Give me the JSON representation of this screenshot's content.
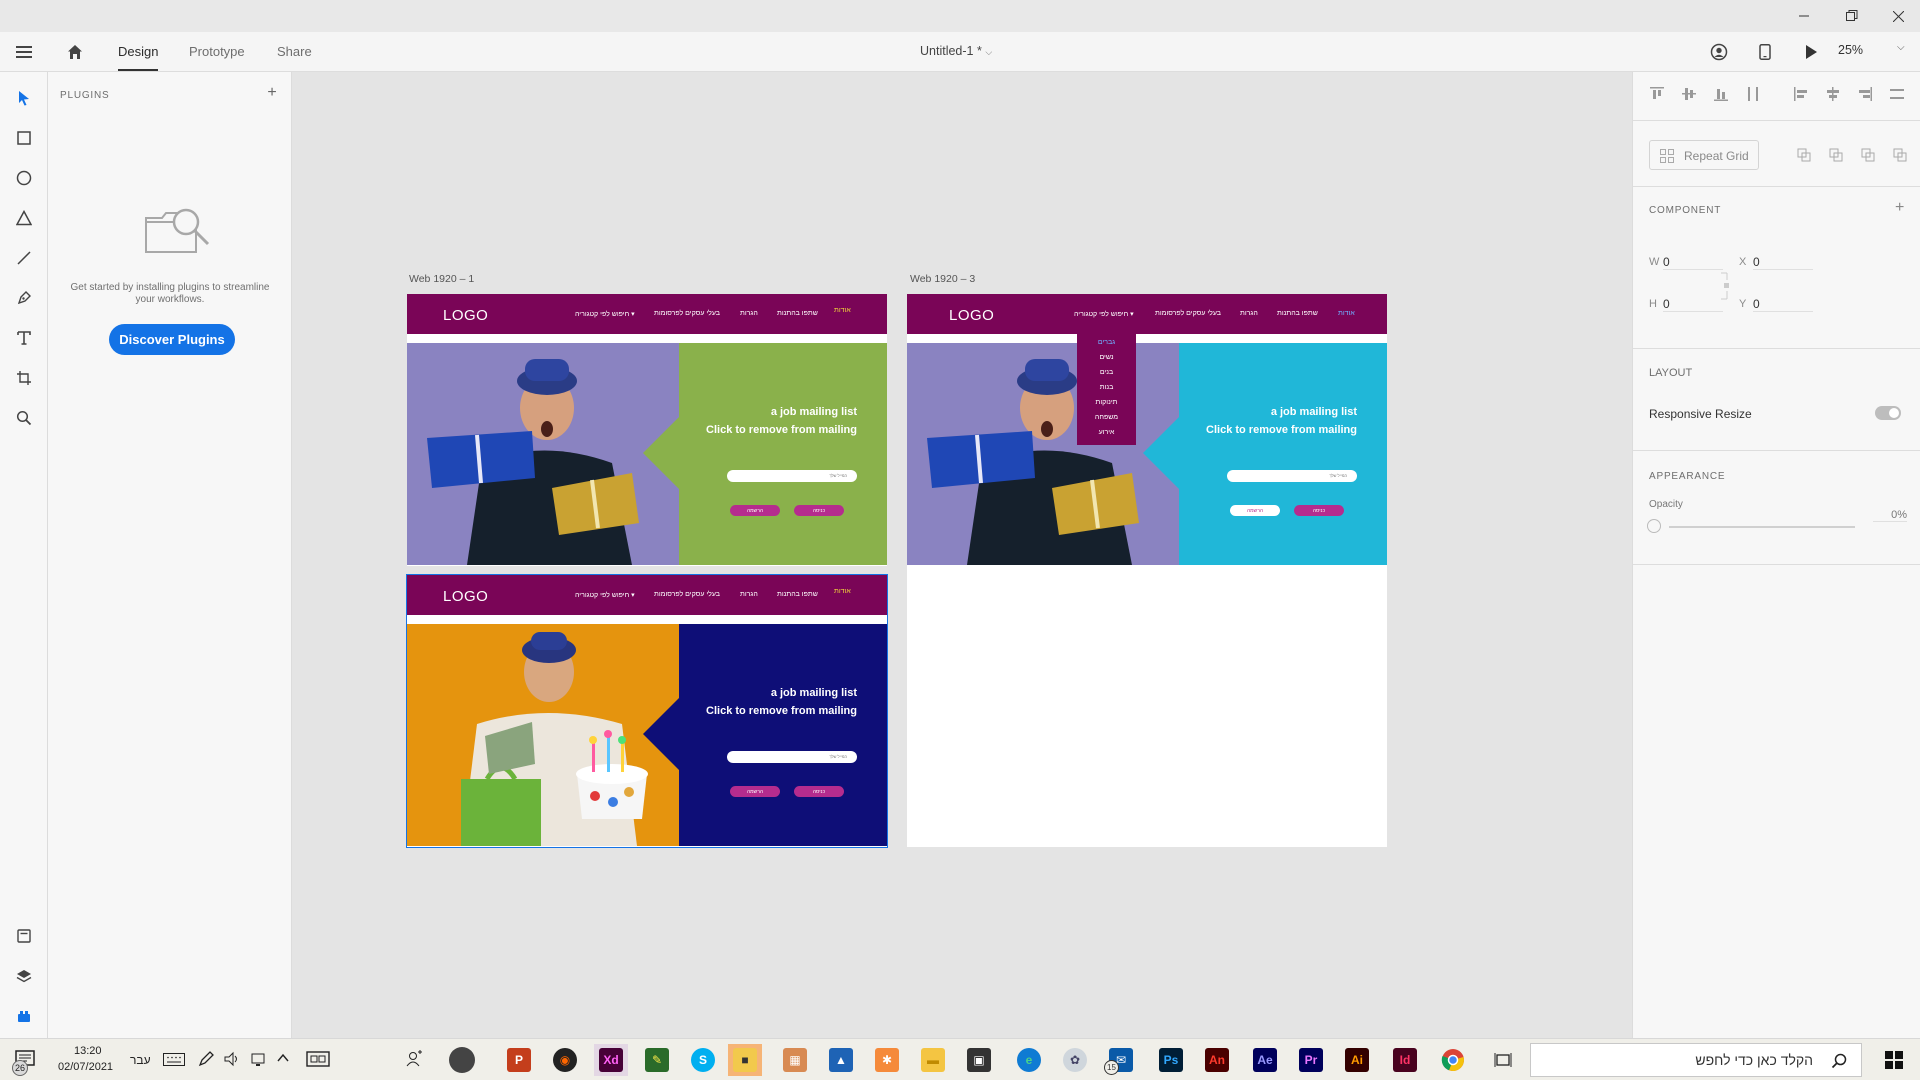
{
  "window": {
    "controls": [
      "minimize-icon",
      "restore-icon",
      "close-icon"
    ]
  },
  "appbar": {
    "tabs": [
      {
        "label": "Design"
      },
      {
        "label": "Prototype"
      },
      {
        "label": "Share"
      }
    ],
    "document_title": "Untitled-1 *",
    "zoom": "25%"
  },
  "plugins_panel": {
    "header": "PLUGINS",
    "description": "Get started by installing plugins to streamline your workflows.",
    "discover_button": "Discover Plugins"
  },
  "artboards": [
    {
      "label": "Web 1920 – 1",
      "logo": "LOGO",
      "nav": [
        "אודות",
        "שתפו בהתנות",
        "הגרות",
        "בעלי עסקים לפרסומות",
        "חיפוש לפי קטגוריה ▾"
      ],
      "headline1": "a job mailing list",
      "headline2": "Click to remove from mailing",
      "field_placeholder": "המייל שלך",
      "btn_register": "הרשמה",
      "btn_login": "כניסה",
      "panel_color": "#8ab14b"
    },
    {
      "label": "Web 1920 – 3",
      "logo": "LOGO",
      "nav": [
        "אודות",
        "שתפו בהתנות",
        "הגרות",
        "בעלי עסקים לפרסומות",
        "חיפוש לפי קטגוריה ▾"
      ],
      "dropdown": [
        "גברים",
        "נשים",
        "בנים",
        "בנות",
        "תינוקות",
        "משפחה",
        "אירוע"
      ],
      "headline1": "a job mailing list",
      "headline2": "Click to remove from mailing",
      "field_placeholder": "המייל שלך",
      "btn_register": "הרשמה",
      "btn_login": "כניסה",
      "panel_color": "#20b7d8"
    },
    {
      "logo": "LOGO",
      "nav": [
        "אודות",
        "שתפו בהתנות",
        "הגרות",
        "בעלי עסקים לפרסומות",
        "חיפוש לפי קטגוריה ▾"
      ],
      "headline1": "a job mailing list",
      "headline2": "Click to remove from mailing",
      "field_placeholder": "המייל שלך",
      "btn_register": "הרשמה",
      "btn_login": "כניסה",
      "panel_color": "#0e0e77"
    }
  ],
  "properties": {
    "repeat_grid": "Repeat Grid",
    "component_header": "COMPONENT",
    "w_label": "W",
    "w_value": "0",
    "h_label": "H",
    "h_value": "0",
    "x_label": "X",
    "x_value": "0",
    "y_label": "Y",
    "y_value": "0",
    "layout_header": "LAYOUT",
    "responsive_resize": "Responsive Resize",
    "appearance_header": "APPEARANCE",
    "opacity_label": "Opacity",
    "opacity_value": "0%"
  },
  "taskbar": {
    "search_placeholder": "הקלד כאן כדי לחפש",
    "time": "13:20",
    "date": "02/07/2021",
    "language": "עבר",
    "notification_count": "26",
    "mail_badge": "15",
    "apps": [
      {
        "name": "powerpoint",
        "letter": "P",
        "bg": "#c43e1c",
        "fg": "#fff"
      },
      {
        "name": "media-player",
        "letter": "◉",
        "bg": "#222",
        "fg": "#f60"
      },
      {
        "name": "adobe-xd",
        "letter": "Xd",
        "bg": "#470137",
        "fg": "#ff61f6"
      },
      {
        "name": "skype",
        "letter": "S",
        "bg": "#00aff0",
        "fg": "#fff"
      },
      {
        "name": "sticky-notes",
        "letter": "■",
        "bg": "#f2c94c",
        "fg": "#333"
      },
      {
        "name": "photos",
        "letter": "▲",
        "bg": "#1e63b5",
        "fg": "#fff"
      },
      {
        "name": "file-explorer",
        "letter": "▬",
        "bg": "#f4c542",
        "fg": "#c08a00"
      },
      {
        "name": "store",
        "letter": "▣",
        "bg": "#333",
        "fg": "#fff"
      },
      {
        "name": "edge",
        "letter": "e",
        "bg": "#0f7bd3",
        "fg": "#48d28a"
      },
      {
        "name": "mail",
        "letter": "✉",
        "bg": "#0a5aa8",
        "fg": "#fff"
      },
      {
        "name": "photoshop",
        "letter": "Ps",
        "bg": "#001e36",
        "fg": "#31a8ff"
      },
      {
        "name": "animate",
        "letter": "An",
        "bg": "#4a0000",
        "fg": "#ff3a2c"
      },
      {
        "name": "after-effects",
        "letter": "Ae",
        "bg": "#00005b",
        "fg": "#9999ff"
      },
      {
        "name": "premiere",
        "letter": "Pr",
        "bg": "#00005b",
        "fg": "#ea77ff"
      },
      {
        "name": "illustrator",
        "letter": "Ai",
        "bg": "#330000",
        "fg": "#ff9a00"
      },
      {
        "name": "indesign",
        "letter": "Id",
        "bg": "#49021f",
        "fg": "#ff3366"
      },
      {
        "name": "chrome",
        "letter": "●",
        "bg": "#fff",
        "fg": "#db4437"
      }
    ]
  }
}
